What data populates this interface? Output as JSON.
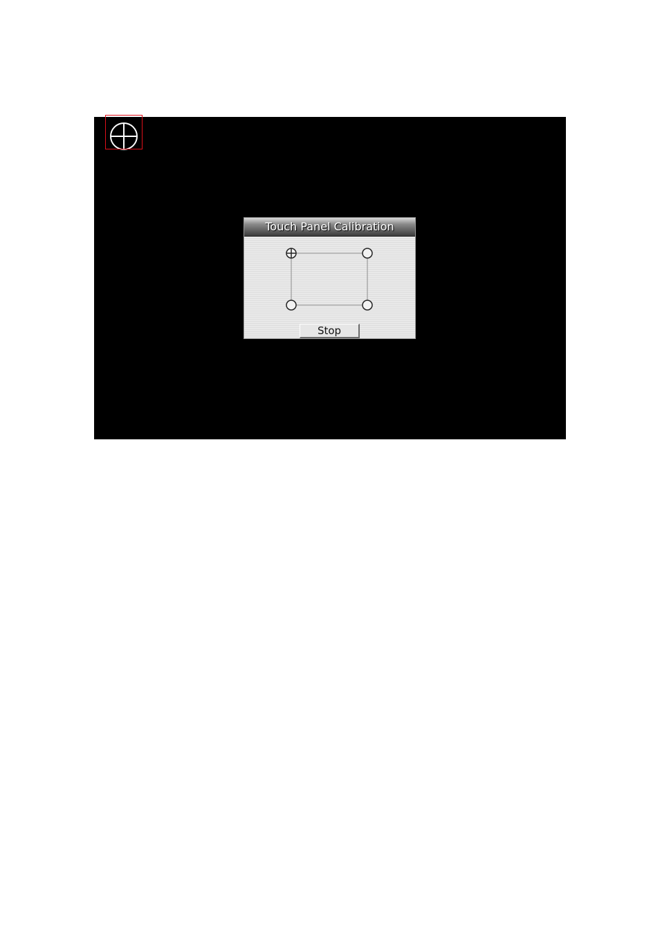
{
  "dialog": {
    "title": "Touch Panel Calibration",
    "stop_label": "Stop"
  },
  "calibration": {
    "active_point": "top-left",
    "points": [
      "top-left",
      "top-right",
      "bottom-left",
      "bottom-right"
    ]
  },
  "icons": {
    "target": "crosshair-target-icon",
    "pending_point": "circle-icon",
    "active_point": "crosshair-circle-icon"
  },
  "colors": {
    "screen_background": "#000000",
    "highlight_border": "#e0101a",
    "target_stroke": "#ffffff"
  }
}
